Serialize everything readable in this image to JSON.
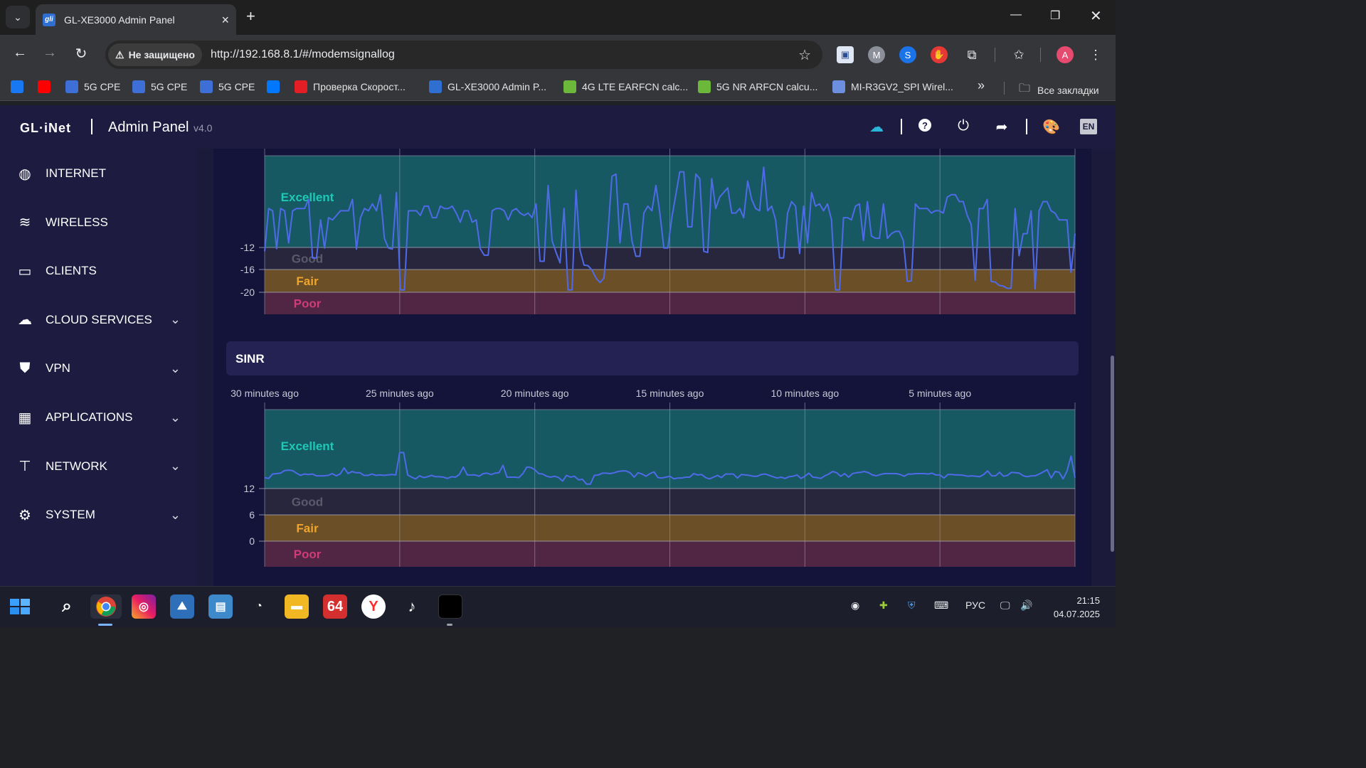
{
  "browser": {
    "tab_title": "GL-XE3000 Admin Panel",
    "tab_favicon_text": "gli",
    "security_label": "Не защищено",
    "url": "http://192.168.8.1/#/modemsignallog",
    "profile_initial": "A",
    "bookmarks": [
      {
        "label": "",
        "icon": "facebook-icon",
        "color": "#1877f2"
      },
      {
        "label": "",
        "icon": "youtube-icon",
        "color": "#ff0000"
      },
      {
        "label": "5G CPE",
        "icon": "site-icon",
        "color": "#3d6fd6"
      },
      {
        "label": "5G CPE",
        "icon": "site-icon",
        "color": "#3d6fd6"
      },
      {
        "label": "5G CPE",
        "icon": "site-icon",
        "color": "#3d6fd6"
      },
      {
        "label": "",
        "icon": "vk-icon",
        "color": "#0077ff"
      },
      {
        "label": "Проверка Скорост...",
        "icon": "speedtest-icon",
        "color": "#e31e24"
      },
      {
        "label": "GL-XE3000 Admin P...",
        "icon": "gli-icon",
        "color": "#2f6fd1"
      },
      {
        "label": "4G LTE EARFCN calc...",
        "icon": "bars-icon",
        "color": "#6cb83a"
      },
      {
        "label": "5G NR ARFCN calcu...",
        "icon": "bars-icon",
        "color": "#6cb83a"
      },
      {
        "label": "MI-R3GV2_SPI Wirel...",
        "icon": "antenna-icon",
        "color": "#6d8fe0"
      }
    ],
    "more_bookmarks": "»",
    "all_bookmarks": "Все закладки"
  },
  "app": {
    "logo": "GL·iNet",
    "title": "Admin Panel",
    "version": "v4.0",
    "lang": "EN",
    "sidebar": [
      {
        "label": "INTERNET",
        "icon": "globe-icon",
        "expandable": false
      },
      {
        "label": "WIRELESS",
        "icon": "wifi-icon",
        "expandable": false
      },
      {
        "label": "CLIENTS",
        "icon": "devices-icon",
        "expandable": false
      },
      {
        "label": "CLOUD SERVICES",
        "icon": "cloud-icon",
        "expandable": true
      },
      {
        "label": "VPN",
        "icon": "shield-icon",
        "expandable": true
      },
      {
        "label": "APPLICATIONS",
        "icon": "apps-grid-icon",
        "expandable": true
      },
      {
        "label": "NETWORK",
        "icon": "network-icon",
        "expandable": true
      },
      {
        "label": "SYSTEM",
        "icon": "gear-icon",
        "expandable": true
      }
    ]
  },
  "chart_data": [
    {
      "type": "line",
      "title": "",
      "xlabel": "",
      "ylabel": "",
      "time_labels": [],
      "x_range_minutes": [
        -30,
        0
      ],
      "y_ticks": [
        -12,
        -16,
        -20
      ],
      "ylim": [
        -24,
        -8
      ],
      "zones": [
        {
          "label": "Excellent",
          "from": -12,
          "to": -8,
          "color": "#17666a"
        },
        {
          "label": "Good",
          "from": -16,
          "to": -12,
          "color": "#2a2a3e"
        },
        {
          "label": "Fair",
          "from": -20,
          "to": -16,
          "color": "#7a5a25"
        },
        {
          "label": "Poor",
          "from": -24,
          "to": -20,
          "color": "#5a2a47"
        }
      ],
      "series": [
        {
          "color": "#4f6ae8",
          "values": [
            -12.7,
            -10.3,
            -10.4,
            -12.2,
            -10.3,
            -10.4,
            -11.8,
            -10.4,
            -10.3,
            -10.3,
            -10.3,
            -9.9,
            -13.9,
            -13.9,
            -10.8,
            -12.1,
            -10.7,
            -10.8,
            -10.6,
            -10.4,
            -10.4,
            -10.4,
            -9.9,
            -12.3,
            -10.7,
            -10.3,
            -10.4,
            -10.1,
            -10.4,
            -9.7,
            -11.6,
            -12.1,
            -12.3,
            -9.6,
            -19.6,
            -19.6,
            -10.4,
            -10.4,
            -10.4,
            -10.6,
            -10.2,
            -10.2,
            -10.7,
            -10.7,
            -10.2,
            -10.3,
            -10.3,
            -10.2,
            -10.5,
            -10.9,
            -10.4,
            -10.4,
            -10.9,
            -10.8,
            -12.2,
            -13.4,
            -13.4,
            -10.4,
            -10.3,
            -10.3,
            -10.4,
            -10.8,
            -10.4,
            -10.3,
            -10.5,
            -10.6,
            -10.5,
            -10.7,
            -10.1,
            -14.5,
            -14.5,
            -9.3,
            -11.7,
            -12.9,
            -14.8,
            -10.3,
            -19.6,
            -19.6,
            -9.5,
            -12.5,
            -15.2,
            -15.3,
            -16.1,
            -17.5,
            -18.3,
            -17.5,
            -11.4,
            -8.9,
            -8.8,
            -11.8,
            -10.1,
            -10.1,
            -11.7,
            -13.6,
            -13.6,
            -10.5,
            -10.2,
            -10.4,
            -9.3,
            -10.5,
            -12.1,
            -12.1,
            -10.7,
            -9.7,
            -8.7,
            -8.7,
            -11.1,
            -11.1,
            -8.8,
            -9.0,
            -12.7,
            -12.9,
            -9.0,
            -10.3,
            -9.8,
            -9.6,
            -9.4,
            -10.5,
            -10.5,
            -10.3,
            -10.7,
            -9.1,
            -9.9,
            -10.3,
            -10.4,
            -8.5,
            -10.4,
            -10.2,
            -10.8,
            -13.9,
            -13.9,
            -10.5,
            -10.0,
            -10.2,
            -13.1,
            -10.2,
            -11.8,
            -9.6,
            -10.2,
            -10.1,
            -10.4,
            -10.1,
            -10.8,
            -19.6,
            -19.6,
            -10.7,
            -10.7,
            -10.8,
            -10.2,
            -10.1,
            -11.7,
            -10.0,
            -11.5,
            -11.6,
            -11.6,
            -10.1,
            -11.6,
            -11.4,
            -11.3,
            -11.3,
            -11.7,
            -18.1,
            -18.0,
            -10.1,
            -10.3,
            -10.3,
            -10.3,
            -10.5,
            -10.4,
            -10.4,
            -10.5,
            -9.8,
            -9.7,
            -9.7,
            -10.0,
            -10.0,
            -10.6,
            -11.0,
            -17.9,
            -10.3,
            -10.3,
            -9.9,
            -18.1,
            -18.2,
            -18.8,
            -18.9,
            -19.3,
            -19.3,
            -10.3,
            -13.5,
            -11.4,
            -11.4,
            -10.4,
            -19.4,
            -10.4,
            -10.0,
            -10.0,
            -10.4,
            -10.5,
            -10.8,
            -10.8,
            -10.8,
            -16.5,
            -11.4
          ]
        }
      ]
    },
    {
      "type": "line",
      "title": "SINR",
      "xlabel": "",
      "ylabel": "",
      "time_labels": [
        "30 minutes ago",
        "25 minutes ago",
        "20 minutes ago",
        "15 minutes ago",
        "10 minutes ago",
        "5 minutes ago"
      ],
      "x_range_minutes": [
        -30,
        0
      ],
      "y_ticks": [
        12,
        6,
        0
      ],
      "ylim": [
        -6,
        30
      ],
      "zones": [
        {
          "label": "Excellent",
          "from": 12,
          "to": 30,
          "color": "#17666a"
        },
        {
          "label": "Good",
          "from": 6,
          "to": 12,
          "color": "#2a2a3e"
        },
        {
          "label": "Fair",
          "from": 0,
          "to": 6,
          "color": "#7a5a25"
        },
        {
          "label": "Poor",
          "from": -6,
          "to": 0,
          "color": "#5a2a47"
        }
      ],
      "series": [
        {
          "color": "#4f6ae8",
          "values": [
            14.5,
            14.3,
            15.3,
            15.4,
            15.5,
            16.1,
            16.2,
            16.1,
            15.5,
            15.0,
            15.3,
            15.2,
            15.3,
            14.9,
            14.9,
            14.9,
            15.0,
            15.4,
            14.9,
            15.3,
            16.7,
            15.4,
            15.9,
            15.6,
            15.6,
            15.0,
            15.0,
            15.3,
            15.0,
            15.1,
            15.0,
            15.1,
            15.2,
            15.1,
            20.2,
            20.2,
            15.1,
            14.6,
            14.2,
            14.9,
            14.5,
            14.7,
            15.0,
            14.7,
            14.7,
            14.6,
            14.3,
            14.7,
            14.6,
            15.2,
            16.9,
            15.1,
            15.1,
            15.1,
            14.8,
            15.4,
            15.5,
            15.2,
            15.5,
            15.6,
            17.3,
            14.6,
            14.6,
            14.6,
            14.5,
            15.4,
            16.9,
            16.8,
            16.3,
            15.4,
            15.3,
            14.8,
            14.6,
            14.8,
            14.5,
            13.7,
            15.0,
            14.6,
            14.8,
            14.0,
            14.1,
            13.0,
            13.0,
            15.0,
            15.1,
            15.5,
            15.5,
            15.4,
            15.6,
            15.9,
            16.0,
            16.0,
            15.6,
            14.6,
            15.6,
            15.3,
            14.8,
            15.4,
            15.8,
            14.5,
            14.4,
            14.6,
            14.8,
            14.2,
            14.4,
            14.4,
            14.6,
            14.6,
            15.4,
            15.1,
            15.2,
            14.5,
            14.2,
            14.6,
            15.0,
            14.5,
            15.3,
            15.3,
            15.3,
            14.4,
            15.2,
            15.1,
            15.0,
            14.8,
            14.8,
            15.2,
            15.3,
            15.0,
            14.7,
            14.4,
            14.6,
            14.3,
            14.7,
            14.8,
            15.1,
            14.3,
            14.8,
            15.5,
            14.6,
            14.5,
            14.3,
            14.9,
            15.3,
            15.9,
            15.6,
            14.8,
            15.4,
            14.6,
            15.4,
            15.6,
            15.7,
            15.9,
            15.6,
            15.1,
            14.9,
            15.2,
            15.4,
            15.4,
            15.4,
            15.4,
            15.2,
            14.8,
            15.3,
            15.3,
            15.4,
            15.4,
            15.4,
            15.3,
            15.5,
            15.1,
            15.1,
            14.4,
            15.2,
            15.2,
            15.1,
            15.1,
            15.0,
            14.8,
            14.9,
            14.8,
            14.7,
            15.2,
            16.0,
            14.9,
            14.9,
            15.7,
            14.8,
            15.0,
            15.7,
            15.6,
            15.5,
            14.9,
            14.7,
            14.9,
            14.9,
            15.3,
            15.8,
            16.3,
            14.4,
            15.9,
            15.7,
            14.2,
            16.0,
            19.4,
            14.5
          ]
        }
      ]
    }
  ],
  "taskbar": {
    "lang": "РУС",
    "time": "21:15",
    "date": "04.07.2025",
    "apps": [
      "start-icon",
      "search-icon",
      "chrome-icon",
      "instagram-icon",
      "photos-icon",
      "control-icon",
      "speedometer-icon",
      "folder-icon",
      "aida64-icon",
      "yandex-icon",
      "tiktok-icon",
      "terminal-icon"
    ],
    "aida_text": "64"
  }
}
